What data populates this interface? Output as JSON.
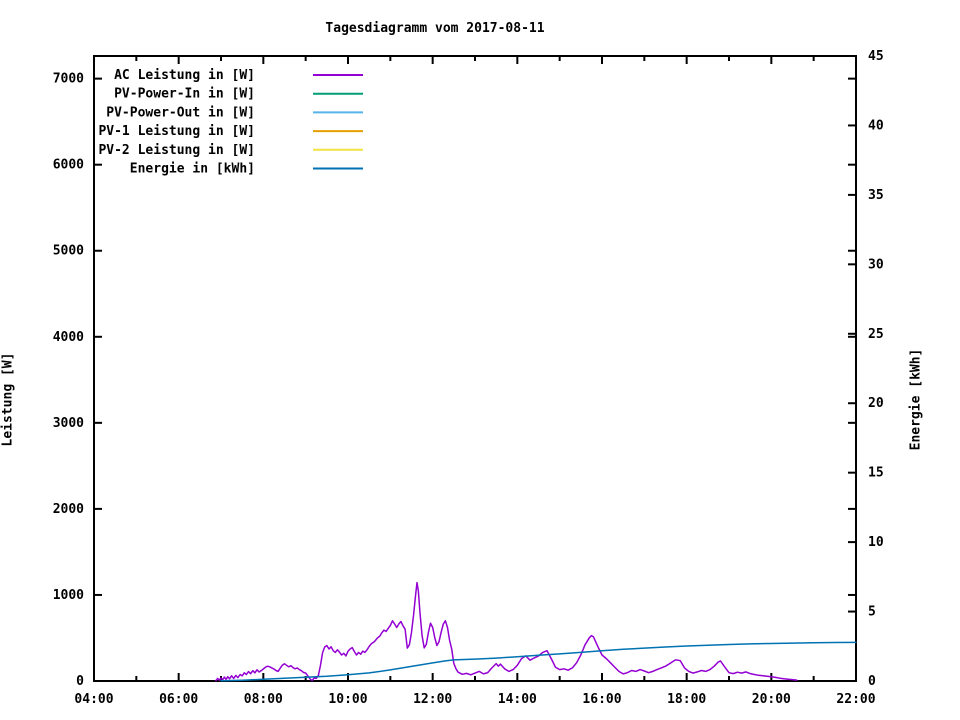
{
  "page": {
    "background": "#ffffff",
    "text_color": "#000000"
  },
  "chart_data": {
    "type": "line",
    "title": "Tagesdiagramm vom 2017-08-11",
    "xlabel": "",
    "x_axis": {
      "range_hours": [
        4,
        22
      ],
      "major_tick_every_hours": 2,
      "minor_tick_every_hours": 1,
      "tick_labels": [
        "04:00",
        "06:00",
        "08:00",
        "10:00",
        "12:00",
        "14:00",
        "16:00",
        "18:00",
        "20:00",
        "22:00"
      ]
    },
    "y_left": {
      "label": "Leistung [W]",
      "range": [
        0,
        7263
      ],
      "ticks": [
        0,
        1000,
        2000,
        3000,
        4000,
        5000,
        6000,
        7000
      ]
    },
    "y_right": {
      "label": "Energie [kWh]",
      "range": [
        0,
        45
      ],
      "ticks": [
        0,
        5,
        10,
        15,
        20,
        25,
        30,
        35,
        40,
        45
      ]
    },
    "grid": "off",
    "legend_position": "top-left-inside",
    "legend": [
      {
        "label": "AC Leistung in [W]",
        "color": "#9400d3"
      },
      {
        "label": "PV-Power-In in [W]",
        "color": "#009e73"
      },
      {
        "label": "PV-Power-Out in [W]",
        "color": "#56b4e9"
      },
      {
        "label": "PV-1 Leistung in [W]",
        "color": "#e69f00"
      },
      {
        "label": "PV-2 Leistung in [W]",
        "color": "#f0e442"
      },
      {
        "label": "Energie in [kWh]",
        "color": "#0072b2"
      }
    ],
    "series": [
      {
        "name": "AC Leistung in [W]",
        "color": "#9400d3",
        "axis": "left",
        "unit": "W",
        "points": [
          [
            6.88,
            5
          ],
          [
            6.92,
            30
          ],
          [
            6.96,
            10
          ],
          [
            7.0,
            35
          ],
          [
            7.04,
            15
          ],
          [
            7.08,
            45
          ],
          [
            7.12,
            20
          ],
          [
            7.16,
            50
          ],
          [
            7.2,
            25
          ],
          [
            7.25,
            60
          ],
          [
            7.3,
            30
          ],
          [
            7.35,
            65
          ],
          [
            7.4,
            40
          ],
          [
            7.45,
            75
          ],
          [
            7.5,
            60
          ],
          [
            7.55,
            95
          ],
          [
            7.6,
            75
          ],
          [
            7.65,
            110
          ],
          [
            7.7,
            85
          ],
          [
            7.75,
            120
          ],
          [
            7.8,
            95
          ],
          [
            7.85,
            130
          ],
          [
            7.9,
            105
          ],
          [
            7.95,
            120
          ],
          [
            8.0,
            140
          ],
          [
            8.05,
            160
          ],
          [
            8.1,
            172
          ],
          [
            8.15,
            165
          ],
          [
            8.2,
            152
          ],
          [
            8.25,
            140
          ],
          [
            8.3,
            122
          ],
          [
            8.35,
            112
          ],
          [
            8.4,
            150
          ],
          [
            8.45,
            185
          ],
          [
            8.5,
            200
          ],
          [
            8.55,
            182
          ],
          [
            8.6,
            165
          ],
          [
            8.65,
            178
          ],
          [
            8.7,
            156
          ],
          [
            8.75,
            142
          ],
          [
            8.8,
            152
          ],
          [
            8.85,
            132
          ],
          [
            8.9,
            120
          ],
          [
            8.95,
            100
          ],
          [
            9.0,
            92
          ],
          [
            9.05,
            60
          ],
          [
            9.12,
            15
          ],
          [
            9.16,
            8
          ],
          [
            9.2,
            35
          ],
          [
            9.25,
            30
          ],
          [
            9.3,
            65
          ],
          [
            9.35,
            185
          ],
          [
            9.4,
            330
          ],
          [
            9.45,
            395
          ],
          [
            9.5,
            412
          ],
          [
            9.55,
            372
          ],
          [
            9.6,
            398
          ],
          [
            9.65,
            352
          ],
          [
            9.7,
            332
          ],
          [
            9.75,
            362
          ],
          [
            9.8,
            335
          ],
          [
            9.85,
            302
          ],
          [
            9.9,
            322
          ],
          [
            9.95,
            292
          ],
          [
            10.0,
            345
          ],
          [
            10.05,
            372
          ],
          [
            10.1,
            388
          ],
          [
            10.15,
            342
          ],
          [
            10.2,
            302
          ],
          [
            10.25,
            332
          ],
          [
            10.3,
            312
          ],
          [
            10.35,
            348
          ],
          [
            10.4,
            332
          ],
          [
            10.45,
            362
          ],
          [
            10.5,
            402
          ],
          [
            10.55,
            432
          ],
          [
            10.6,
            448
          ],
          [
            10.65,
            472
          ],
          [
            10.7,
            502
          ],
          [
            10.75,
            522
          ],
          [
            10.8,
            562
          ],
          [
            10.85,
            592
          ],
          [
            10.9,
            575
          ],
          [
            10.95,
            612
          ],
          [
            11.0,
            645
          ],
          [
            11.05,
            700
          ],
          [
            11.1,
            662
          ],
          [
            11.15,
            622
          ],
          [
            11.2,
            662
          ],
          [
            11.25,
            692
          ],
          [
            11.3,
            642
          ],
          [
            11.35,
            602
          ],
          [
            11.4,
            382
          ],
          [
            11.45,
            422
          ],
          [
            11.5,
            565
          ],
          [
            11.55,
            770
          ],
          [
            11.6,
            1010
          ],
          [
            11.63,
            1143
          ],
          [
            11.66,
            1050
          ],
          [
            11.7,
            790
          ],
          [
            11.75,
            525
          ],
          [
            11.8,
            385
          ],
          [
            11.85,
            425
          ],
          [
            11.9,
            565
          ],
          [
            11.95,
            672
          ],
          [
            12.0,
            622
          ],
          [
            12.05,
            502
          ],
          [
            12.1,
            412
          ],
          [
            12.15,
            455
          ],
          [
            12.2,
            565
          ],
          [
            12.25,
            662
          ],
          [
            12.3,
            700
          ],
          [
            12.35,
            622
          ],
          [
            12.4,
            472
          ],
          [
            12.45,
            372
          ],
          [
            12.5,
            205
          ],
          [
            12.55,
            142
          ],
          [
            12.6,
            102
          ],
          [
            12.7,
            78
          ],
          [
            12.8,
            88
          ],
          [
            12.9,
            72
          ],
          [
            13.0,
            92
          ],
          [
            13.1,
            112
          ],
          [
            13.2,
            82
          ],
          [
            13.3,
            98
          ],
          [
            13.4,
            152
          ],
          [
            13.5,
            202
          ],
          [
            13.55,
            172
          ],
          [
            13.6,
            196
          ],
          [
            13.7,
            142
          ],
          [
            13.8,
            112
          ],
          [
            13.9,
            132
          ],
          [
            14.0,
            182
          ],
          [
            14.1,
            262
          ],
          [
            14.2,
            292
          ],
          [
            14.3,
            242
          ],
          [
            14.4,
            268
          ],
          [
            14.5,
            292
          ],
          [
            14.6,
            332
          ],
          [
            14.7,
            352
          ],
          [
            14.8,
            262
          ],
          [
            14.9,
            162
          ],
          [
            15.0,
            132
          ],
          [
            15.1,
            142
          ],
          [
            15.2,
            126
          ],
          [
            15.3,
            152
          ],
          [
            15.4,
            212
          ],
          [
            15.5,
            302
          ],
          [
            15.6,
            422
          ],
          [
            15.7,
            502
          ],
          [
            15.75,
            528
          ],
          [
            15.8,
            512
          ],
          [
            15.9,
            402
          ],
          [
            16.0,
            302
          ],
          [
            16.1,
            262
          ],
          [
            16.2,
            212
          ],
          [
            16.3,
            162
          ],
          [
            16.4,
            112
          ],
          [
            16.5,
            82
          ],
          [
            16.6,
            96
          ],
          [
            16.7,
            122
          ],
          [
            16.8,
            112
          ],
          [
            16.9,
            132
          ],
          [
            17.0,
            116
          ],
          [
            17.1,
            96
          ],
          [
            17.2,
            112
          ],
          [
            17.3,
            132
          ],
          [
            17.4,
            152
          ],
          [
            17.5,
            172
          ],
          [
            17.6,
            202
          ],
          [
            17.7,
            236
          ],
          [
            17.75,
            246
          ],
          [
            17.85,
            236
          ],
          [
            17.95,
            152
          ],
          [
            18.05,
            112
          ],
          [
            18.15,
            92
          ],
          [
            18.25,
            106
          ],
          [
            18.35,
            122
          ],
          [
            18.45,
            112
          ],
          [
            18.55,
            132
          ],
          [
            18.65,
            172
          ],
          [
            18.75,
            222
          ],
          [
            18.8,
            232
          ],
          [
            18.9,
            162
          ],
          [
            19.0,
            96
          ],
          [
            19.1,
            86
          ],
          [
            19.2,
            102
          ],
          [
            19.3,
            92
          ],
          [
            19.4,
            106
          ],
          [
            19.5,
            86
          ],
          [
            19.6,
            76
          ],
          [
            19.7,
            66
          ],
          [
            19.8,
            62
          ],
          [
            19.9,
            56
          ],
          [
            20.0,
            50
          ],
          [
            20.1,
            42
          ],
          [
            20.2,
            32
          ],
          [
            20.3,
            26
          ],
          [
            20.4,
            20
          ],
          [
            20.5,
            16
          ],
          [
            20.6,
            10
          ]
        ]
      },
      {
        "name": "Energie in [kWh]",
        "color": "#0072b2",
        "axis": "right",
        "unit": "kWh",
        "points": [
          [
            7.0,
            0.02
          ],
          [
            7.5,
            0.06
          ],
          [
            8.0,
            0.12
          ],
          [
            8.5,
            0.2
          ],
          [
            9.0,
            0.27
          ],
          [
            9.5,
            0.34
          ],
          [
            10.0,
            0.45
          ],
          [
            10.5,
            0.58
          ],
          [
            11.0,
            0.8
          ],
          [
            11.5,
            1.05
          ],
          [
            12.0,
            1.3
          ],
          [
            12.3,
            1.45
          ],
          [
            12.5,
            1.52
          ],
          [
            13.0,
            1.58
          ],
          [
            13.5,
            1.65
          ],
          [
            14.0,
            1.75
          ],
          [
            14.5,
            1.86
          ],
          [
            15.0,
            1.95
          ],
          [
            15.5,
            2.06
          ],
          [
            16.0,
            2.18
          ],
          [
            16.5,
            2.28
          ],
          [
            17.0,
            2.37
          ],
          [
            17.5,
            2.45
          ],
          [
            18.0,
            2.52
          ],
          [
            18.5,
            2.58
          ],
          [
            19.0,
            2.63
          ],
          [
            19.5,
            2.67
          ],
          [
            20.0,
            2.7
          ],
          [
            20.5,
            2.73
          ],
          [
            21.0,
            2.75
          ],
          [
            21.5,
            2.77
          ],
          [
            22.0,
            2.78
          ]
        ]
      }
    ]
  }
}
